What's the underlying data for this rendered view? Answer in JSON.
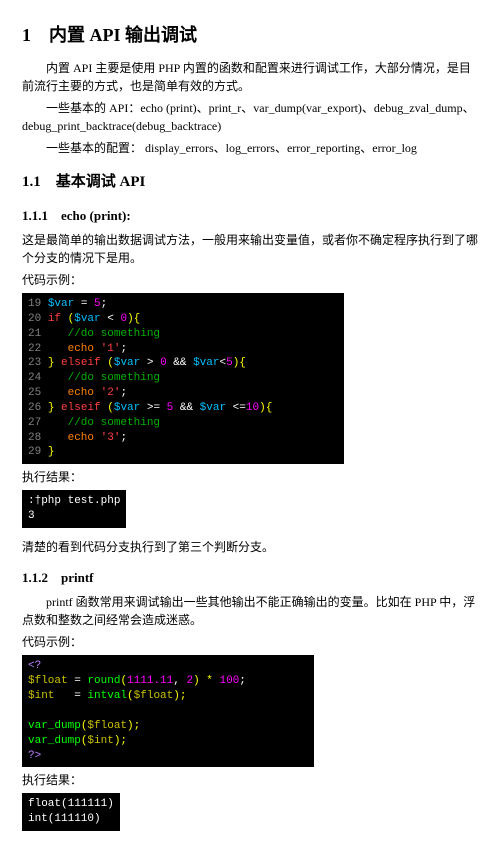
{
  "h1": "1 内置 API 输出调试",
  "p1": "内置 API 主要是使用 PHP 内置的函数和配置来进行调试工作，大部分情况，是目前流行主要的方式，也是简单有效的方式。",
  "p2": "一些基本的 API：echo (print)、print_r、var_dump(var_export)、debug_zval_dump、debug_print_backtrace(debug_backtrace)",
  "p3": "一些基本的配置： display_errors、log_errors、error_reporting、error_log",
  "h2": "1.1 基本调试 API",
  "h3a": "1.1.1 echo (print):",
  "p4": "这是最简单的输出数据调试方法，一般用来输出变量值，或者你不确定程序执行到了哪个分支的情况下是用。",
  "lbl_code": "代码示例：",
  "lbl_result": "执行结果：",
  "code1": {
    "l19n": "19",
    "l19a": "$var",
    "l19b": " = ",
    "l19c": "5",
    "l19d": ";",
    "l20n": "20",
    "l20a": "if ",
    "l20b": "(",
    "l20c": "$var",
    "l20d": " < ",
    "l20e": "0",
    "l20f": "){",
    "l21n": "21",
    "l21a": "    //do something",
    "l22n": "22",
    "l22a": "    echo ",
    "l22b": "'1'",
    "l22c": ";",
    "l23n": "23",
    "l23a": "} ",
    "l23b": "elseif ",
    "l23c": "(",
    "l23d": "$var",
    "l23e": " > ",
    "l23f": "0",
    "l23g": " && ",
    "l23h": "$var",
    "l23i": "<",
    "l23j": "5",
    "l23k": "){",
    "l24n": "24",
    "l24a": "    //do something",
    "l25n": "25",
    "l25a": "    echo ",
    "l25b": "'2'",
    "l25c": ";",
    "l26n": "26",
    "l26a": "} ",
    "l26b": "elseif ",
    "l26c": "(",
    "l26d": "$var",
    "l26e": " >= ",
    "l26f": "5",
    "l26g": " && ",
    "l26h": "$var",
    "l26i": " <=",
    "l26j": "10",
    "l26k": "){",
    "l27n": "27",
    "l27a": "    //do something",
    "l28n": "28",
    "l28a": "    echo ",
    "l28b": "'3'",
    "l28c": ";",
    "l29n": "29",
    "l29a": "}"
  },
  "out1a": ":†php test.php",
  "out1b": "3",
  "p5": "清楚的看到代码分支执行到了第三个判断分支。",
  "h3b": "1.1.2 printf",
  "p6": "printf 函数常用来调试输出一些其他输出不能正确输出的变量。比如在 PHP 中，浮点数和整数之间经常会造成迷惑。",
  "code2": {
    "l1": "<?",
    "l2a": "$float",
    "l2b": " = ",
    "l2c": "round",
    "l2d": "(",
    "l2e": "1111.11",
    "l2f": ", ",
    "l2g": "2",
    "l2h": ") * ",
    "l2i": "100",
    "l2j": ";",
    "l3a": "$int",
    "l3b": "   = ",
    "l3c": "intval",
    "l3d": "(",
    "l3e": "$float",
    "l3f": ");",
    "blank": "",
    "l4a": "var_dump",
    "l4b": "(",
    "l4c": "$float",
    "l4d": ");",
    "l5a": "var_dump",
    "l5b": "(",
    "l5c": "$int",
    "l5d": ");",
    "l6": "?>"
  },
  "out2a": "float(111111)",
  "out2b": "int(111110)"
}
